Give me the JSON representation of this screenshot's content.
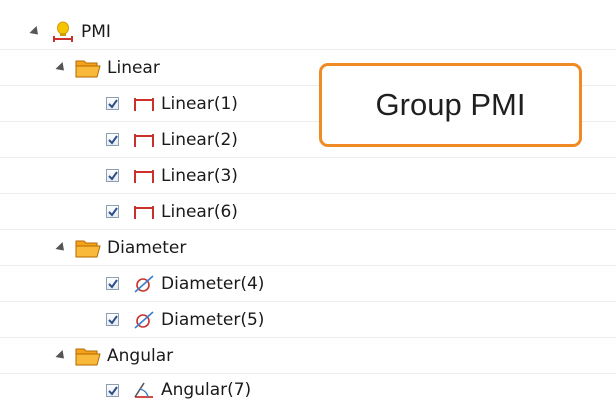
{
  "tree": {
    "root": {
      "label": "PMI",
      "icon": "pmi-bulb-icon"
    },
    "groups": [
      {
        "label": "Linear",
        "icon": "folder-icon",
        "items": [
          {
            "label": "Linear(1)",
            "icon": "linear-dimension-icon",
            "checked": true
          },
          {
            "label": "Linear(2)",
            "icon": "linear-dimension-icon",
            "checked": true
          },
          {
            "label": "Linear(3)",
            "icon": "linear-dimension-icon",
            "checked": true
          },
          {
            "label": "Linear(6)",
            "icon": "linear-dimension-icon",
            "checked": true
          }
        ]
      },
      {
        "label": "Diameter",
        "icon": "folder-icon",
        "items": [
          {
            "label": "Diameter(4)",
            "icon": "diameter-dimension-icon",
            "checked": true
          },
          {
            "label": "Diameter(5)",
            "icon": "diameter-dimension-icon",
            "checked": true
          }
        ]
      },
      {
        "label": "Angular",
        "icon": "folder-icon",
        "items": [
          {
            "label": "Angular(7)",
            "icon": "angular-dimension-icon",
            "checked": true
          }
        ]
      }
    ]
  },
  "callout": {
    "text": "Group PMI"
  },
  "colors": {
    "callout_border": "#f08a24",
    "folder": "#f6a21a",
    "dimension_red": "#c8322d",
    "checkmark": "#2b4f8a"
  }
}
